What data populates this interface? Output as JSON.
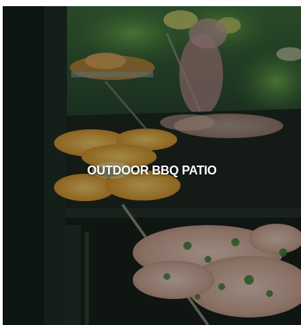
{
  "tile": {
    "title": "OUTDOOR BBQ PATIO",
    "image_subject": "grill-with-food"
  },
  "colors": {
    "caption_text": "#ffffff",
    "overlay": "#0a120e",
    "foliage": "#2f6a34",
    "grill_dark": "#1c2420"
  }
}
